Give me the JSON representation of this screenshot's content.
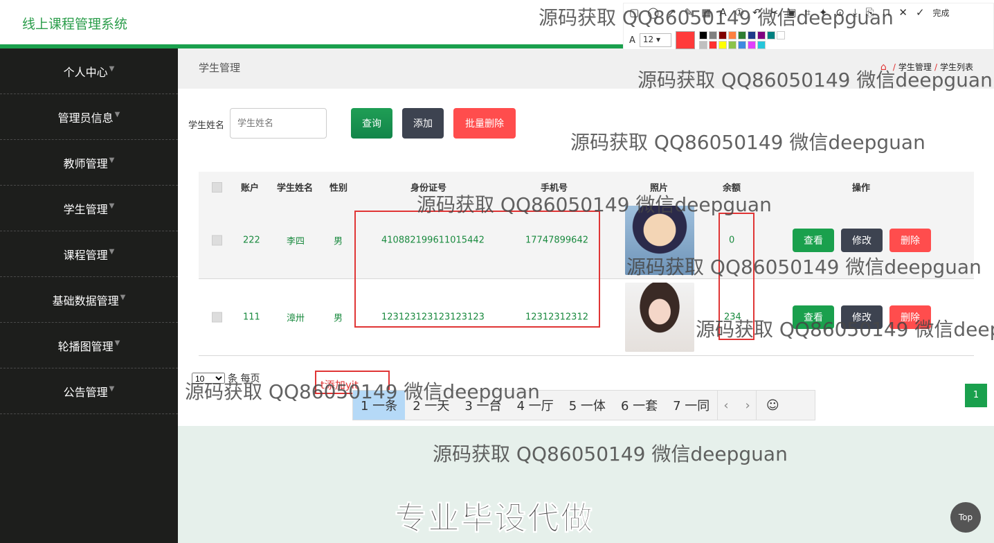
{
  "header": {
    "app_title": "线上课程管理系统"
  },
  "sidebar": {
    "items": [
      {
        "label": "个人中心"
      },
      {
        "label": "管理员信息"
      },
      {
        "label": "教师管理"
      },
      {
        "label": "学生管理"
      },
      {
        "label": "课程管理"
      },
      {
        "label": "基础数据管理"
      },
      {
        "label": "轮播图管理"
      },
      {
        "label": "公告管理"
      }
    ]
  },
  "breadcrumb": {
    "title": "学生管理",
    "path": [
      "学生管理",
      "学生列表"
    ],
    "sep": "/"
  },
  "search": {
    "label": "学生姓名",
    "placeholder": "学生姓名",
    "query_label": "查询",
    "add_label": "添加",
    "batch_delete_label": "批量删除"
  },
  "table": {
    "headers": [
      "账户",
      "学生姓名",
      "性别",
      "身份证号",
      "手机号",
      "照片",
      "余额",
      "操作"
    ],
    "rows": [
      {
        "account": "222",
        "name": "李四",
        "gender": "男",
        "id_number": "410882199611015442",
        "phone": "17747899642",
        "balance": "0"
      },
      {
        "account": "111",
        "name": "漳卅",
        "gender": "男",
        "id_number": "123123123123123123",
        "phone": "12312312312",
        "balance": "234"
      }
    ],
    "actions": {
      "view": "查看",
      "edit": "修改",
      "delete": "删除"
    }
  },
  "pager": {
    "per_page_value": "10",
    "per_page_suffix": "条 每页",
    "current_page": "1"
  },
  "ime": {
    "composition": "t添加yit",
    "candidates": [
      "1 一条",
      "2 一天",
      "3 一台",
      "4 一厅",
      "5 一体",
      "6 一套",
      "7 一同"
    ],
    "prev": "‹",
    "next": "›",
    "emoji": "☺"
  },
  "snap_toolbar": {
    "font_size": "12",
    "done_label": "完成",
    "current_color": "#ff3b3b",
    "palette": [
      "#000000",
      "#808080",
      "#800000",
      "#ff8040",
      "#2e7d32",
      "#1e3a8a",
      "#800080",
      "#008080",
      "#ffffff",
      "#c0c0c0",
      "#ff3030",
      "#ffff00",
      "#8bc34a",
      "#3f8ae0",
      "#e040fb",
      "#26c6da"
    ]
  },
  "watermark": "源码获取 QQ86050149 微信deepguan",
  "promo": "专业毕设代做",
  "top_button": "Top",
  "colors": {
    "primary": "#1aa04d",
    "danger": "#ff4d4d",
    "dark": "#3d4350",
    "sidebar": "#1d1e1c"
  }
}
